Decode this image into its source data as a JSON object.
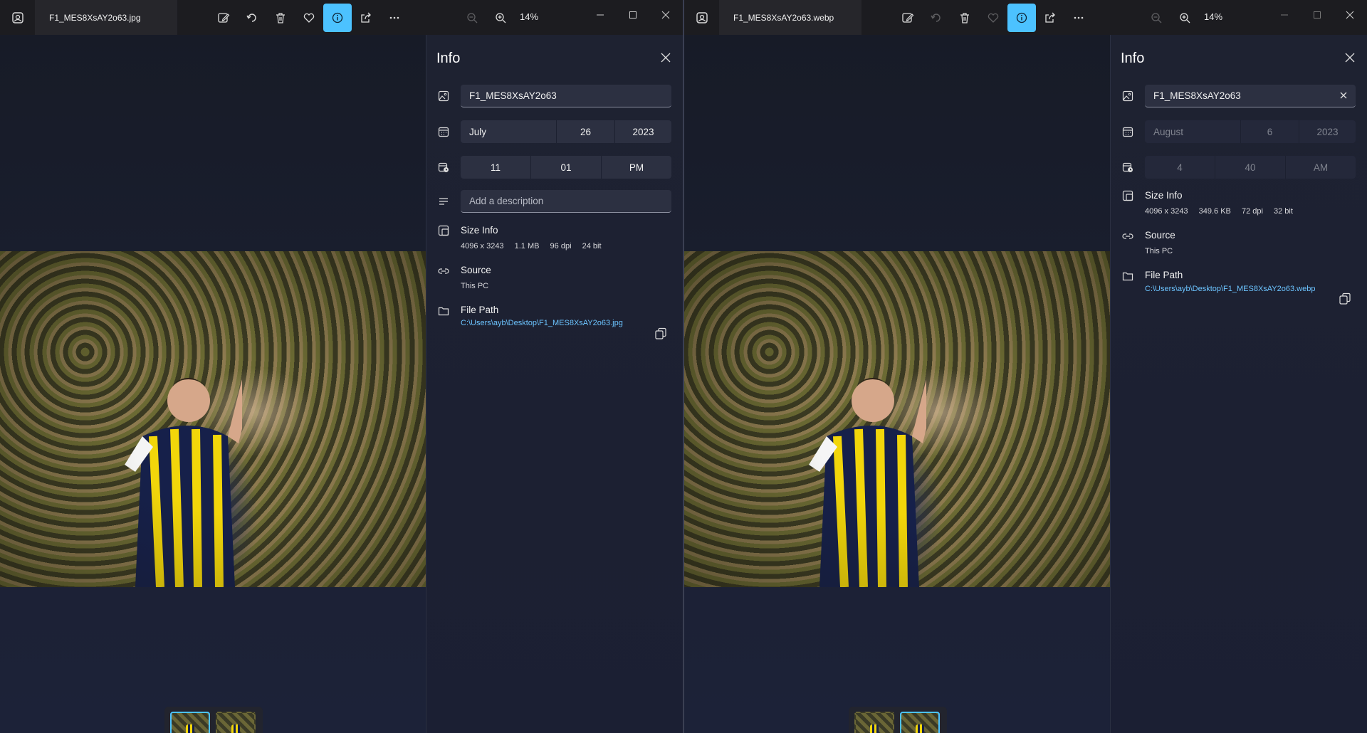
{
  "colors": {
    "accent": "#4cc2ff",
    "link": "#6cc4ff",
    "panel_bg": "#1e2231",
    "titlebar": "#1c1c20"
  },
  "left": {
    "tab_title": "F1_MES8XsAY2o63.jpg",
    "zoom": "14%",
    "info": {
      "title": "Info",
      "file_name": "F1_MES8XsAY2o63",
      "date": {
        "month": "July",
        "day": "26",
        "year": "2023"
      },
      "time": {
        "hour": "11",
        "minute": "01",
        "ampm": "PM"
      },
      "description_placeholder": "Add a description",
      "size_info_label": "Size Info",
      "dimensions": "4096 x 3243",
      "file_size": "1.1 MB",
      "dpi": "96 dpi",
      "bit_depth": "24 bit",
      "source_label": "Source",
      "source_value": "This PC",
      "file_path_label": "File Path",
      "file_path": "C:\\Users\\ayb\\Desktop\\F1_MES8XsAY2o63.jpg"
    }
  },
  "right": {
    "tab_title": "F1_MES8XsAY2o63.webp",
    "zoom": "14%",
    "info": {
      "title": "Info",
      "file_name": "F1_MES8XsAY2o63",
      "date": {
        "month": "August",
        "day": "6",
        "year": "2023"
      },
      "time": {
        "hour": "4",
        "minute": "40",
        "ampm": "AM"
      },
      "size_info_label": "Size Info",
      "dimensions": "4096 x 3243",
      "file_size": "349.6 KB",
      "dpi": "72 dpi",
      "bit_depth": "32 bit",
      "source_label": "Source",
      "source_value": "This PC",
      "file_path_label": "File Path",
      "file_path": "C:\\Users\\ayb\\Desktop\\F1_MES8XsAY2o63.webp"
    }
  }
}
